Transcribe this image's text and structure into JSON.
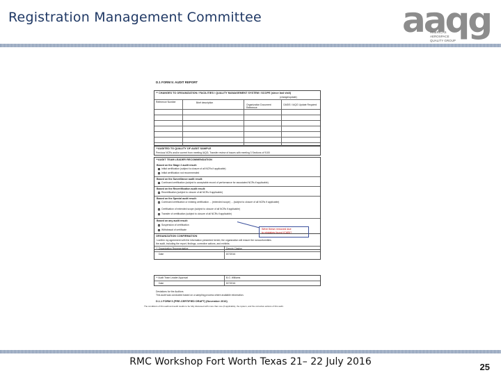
{
  "header": {
    "title": "Registration Management Committee",
    "logo_letters": "aaqg",
    "logo_sub": "AMERICAS AEROSPACE QUALITY GROUP"
  },
  "document": {
    "form_title": "D.1 FORM 5: AUDIT REPORT",
    "sec1": {
      "heading": "** CHANGES TO ORGANIZATION / FACILITIES / QUALITY MANAGEMENT SYSTEM / SCOPE (since last visit)",
      "status": "(change/update)",
      "col_ref": "Reference Number",
      "col_brief": "Brief description",
      "col_org": "Organization Document Reference",
      "col_oasis": "OASIS / IAQG Update Required"
    },
    "sec2": {
      "heading": "**AUDITED TO QUALITY OF AUDIT SAMPLE",
      "text": "Previous NCRs and/or current from meeting IAQG; Transfer review of issues with meeting 3 Sections of 9100"
    },
    "sec3": {
      "heading": "**AUDIT TEAM LEADER RECOMMENDATION",
      "stage2": "Based on the Stage 2 audit result:",
      "s2_items": [
        "Initial certification (subject to closure of all NCRs if applicable)",
        "Initial certification not recommended"
      ],
      "surv": "Based on the Surveillance audit result:",
      "surv_items": [
        "Continued certification (subject to acceptable record of performance for associated NCRs if applicable)"
      ],
      "recert": "Based on the Recertification audit result:",
      "recert_items": [
        "Recertification (subject to closure of all NCRs if applicable)"
      ],
      "special": "Based on the Special audit result:",
      "special_items": [
        "Continued certification or existing certification ... (extended scope) ... (subject to closure of all NCRs if applicable)",
        "Certification of extended scope (subject to closure of all NCRs if applicable)",
        "Transfer of certification (subject to closure of all NCRs if applicable)"
      ],
      "any": "Based on any audit result:",
      "any_items": [
        "Suspension of certification",
        "Withdrawal of certificate"
      ]
    },
    "callout": [
      "Were these removed due",
      "to mistakes found (CAB)?"
    ],
    "sec4": {
      "heading": "ORGANIZATION CONFIRMATION",
      "text1": "I confirm my agreement with the information presented herein; the organization will ensure the nonconformities",
      "text2": "the audit, including the report, findings, corrective actions, and exhibits.",
      "rep_label": "** Organization Representative",
      "rep_value": "Dennis Clayton",
      "date_label": "Date",
      "date_value": "8/7/2016"
    },
    "sec5": {
      "label": "** Audit Team Leader Approval",
      "value": "B.G. Williams",
      "date_label": "Date",
      "date_value": "8/7/2016"
    },
    "closing": {
      "line1": "Deviations for the Auditors",
      "line2": "This audit was conducted based on a sampling process where available information.",
      "bold": "D.1.1 FORM 5 (PRE-CERTIFIED DRAFT) (November 2016)",
      "note": "The conditions of this audit and audit results to be fully discussed with more than one (if applicable), the system, and the corrective actions of this audit."
    }
  },
  "footer": {
    "text": "RMC Workshop Fort Worth Texas 21– 22 July 2016",
    "page": "25"
  }
}
